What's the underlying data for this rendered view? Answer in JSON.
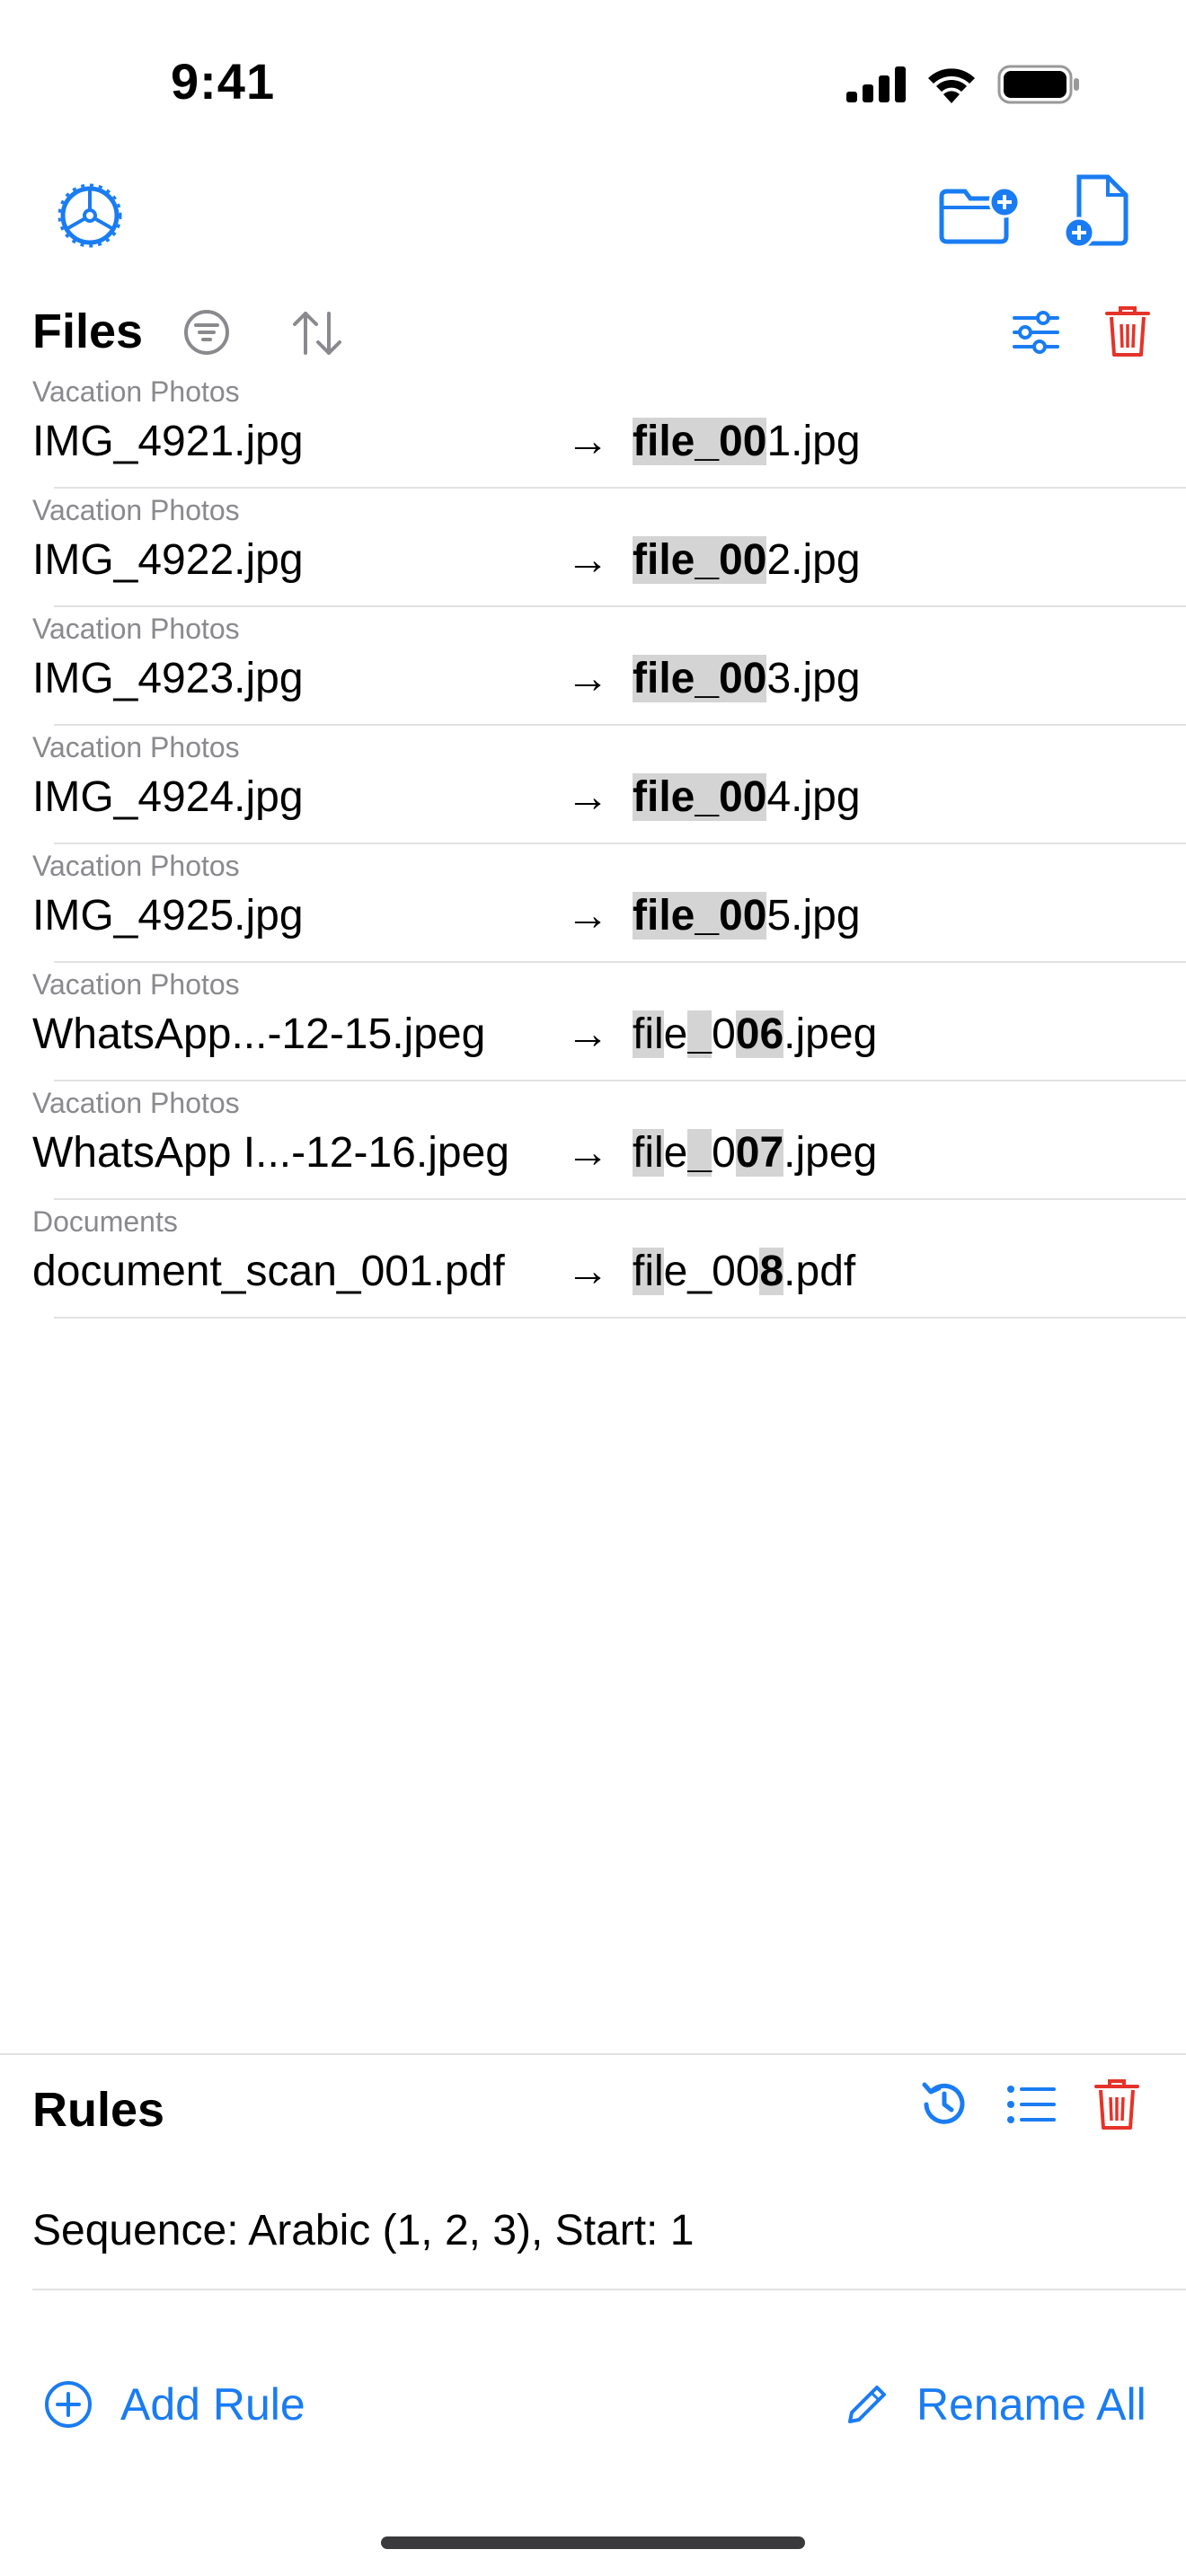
{
  "status_bar": {
    "time": "9:41"
  },
  "files": {
    "title": "Files",
    "rows": [
      {
        "folder": "Vacation Photos",
        "original": "IMG_4921.jpg",
        "arrow": "→",
        "new_parts": [
          [
            "file_00",
            "hl"
          ],
          [
            "1.jpg",
            ""
          ]
        ]
      },
      {
        "folder": "Vacation Photos",
        "original": "IMG_4922.jpg",
        "arrow": "→",
        "new_parts": [
          [
            "file_00",
            "hl"
          ],
          [
            "2.jpg",
            ""
          ]
        ]
      },
      {
        "folder": "Vacation Photos",
        "original": "IMG_4923.jpg",
        "arrow": "→",
        "new_parts": [
          [
            "file_00",
            "hl"
          ],
          [
            "3.jpg",
            ""
          ]
        ]
      },
      {
        "folder": "Vacation Photos",
        "original": "IMG_4924.jpg",
        "arrow": "→",
        "new_parts": [
          [
            "file_00",
            "hl"
          ],
          [
            "4.jpg",
            ""
          ]
        ]
      },
      {
        "folder": "Vacation Photos",
        "original": "IMG_4925.jpg",
        "arrow": "→",
        "new_parts": [
          [
            "file_00",
            "hl"
          ],
          [
            "5.jpg",
            ""
          ]
        ]
      },
      {
        "folder": "Vacation Photos",
        "original": "WhatsApp...-12-15.jpeg",
        "arrow": "→",
        "new_parts": [
          [
            "fil",
            "hl-light"
          ],
          [
            "e",
            ""
          ],
          [
            "_",
            "hl"
          ],
          [
            "0",
            ""
          ],
          [
            "06",
            "hl"
          ],
          [
            ".jpeg",
            ""
          ]
        ]
      },
      {
        "folder": "Vacation Photos",
        "original": "WhatsApp I...-12-16.jpeg",
        "arrow": "→",
        "new_parts": [
          [
            "fil",
            "hl-light"
          ],
          [
            "e",
            ""
          ],
          [
            "_",
            "hl"
          ],
          [
            "0",
            ""
          ],
          [
            "07",
            "hl"
          ],
          [
            ".jpeg",
            ""
          ]
        ]
      },
      {
        "folder": "Documents",
        "original": "document_scan_001.pdf",
        "arrow": "→",
        "new_parts": [
          [
            "fil",
            "hl-light"
          ],
          [
            "e_00",
            ""
          ],
          [
            "8",
            "hl"
          ],
          [
            ".pdf",
            ""
          ]
        ]
      }
    ]
  },
  "rules": {
    "title": "Rules",
    "items": [
      "Sequence: Arabic (1, 2, 3), Start: 1"
    ],
    "add_rule_label": "Add Rule",
    "rename_all_label": "Rename All"
  },
  "colors": {
    "accent": "#1a7cf2",
    "destructive": "#e5332a",
    "secondary_icon": "#8a8a8e"
  }
}
